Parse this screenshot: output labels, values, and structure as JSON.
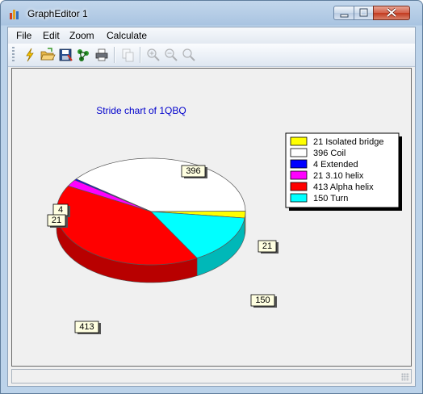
{
  "window": {
    "title": "GraphEditor 1"
  },
  "menu": {
    "items": [
      "File",
      "Edit",
      "Zoom",
      "Calculate"
    ]
  },
  "toolbar": {
    "buttons": [
      "new-icon",
      "open-folder-icon",
      "save-icon",
      "structure-icon",
      "print-icon",
      "copy-icon",
      "zoom-in-icon",
      "zoom-out-icon",
      "zoom-reset-icon"
    ]
  },
  "chart_data": {
    "type": "pie",
    "title": "Stride chart of 1QBQ",
    "slices": [
      {
        "label": "21",
        "legend": "21 Isolated bridge",
        "value": 21,
        "color": "#ffff00"
      },
      {
        "label": "396",
        "legend": "396 Coil",
        "value": 396,
        "color": "#ffffff"
      },
      {
        "label": "4",
        "legend": "4 Extended",
        "value": 4,
        "color": "#0000ff"
      },
      {
        "label": "21",
        "legend": "21 3.10 helix",
        "value": 21,
        "color": "#ff00ff"
      },
      {
        "label": "413",
        "legend": "413 Alpha helix",
        "value": 413,
        "color": "#ff0000"
      },
      {
        "label": "150",
        "legend": "150 Turn",
        "value": 150,
        "color": "#00ffff"
      }
    ],
    "legend_position": "top-right",
    "title_color": "#0000cc"
  }
}
